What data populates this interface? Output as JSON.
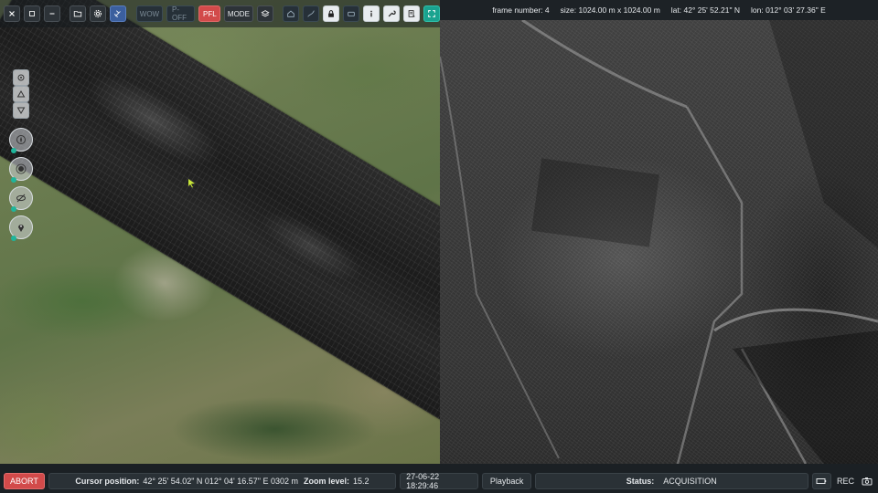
{
  "toolbar": {
    "wow_label": "WOW",
    "poff_label": "P-OFF",
    "pfl_label": "PFL",
    "mode_label": "MODE"
  },
  "sar_info": {
    "frame_label": "frame number:",
    "frame_number": "4",
    "size_label": "size:",
    "size_value": "1024.00 m  x 1024.00 m",
    "lat_label": "lat:",
    "lat_value": "42° 25' 52.21\" N",
    "lon_label": "lon:",
    "lon_value": "012° 03' 27.36\" E"
  },
  "statusbar": {
    "abort_label": "ABORT",
    "cursor_label": "Cursor position:",
    "cursor_value": "42° 25' 54.02\" N 012° 04' 16.57\" E 0302 m",
    "zoom_label": "Zoom level:",
    "zoom_value": "15.2",
    "datetime": "27-06-22 18:29:46",
    "playback_label": "Playback",
    "status_label": "Status:",
    "status_value": "ACQUISITION",
    "rec_label": "REC"
  },
  "icons": [
    "close-icon",
    "window-icon",
    "minimize-icon",
    "folder-icon",
    "gear-icon",
    "satellite-icon",
    "layers-icon",
    "home-icon",
    "route-icon",
    "lock-icon",
    "camera-icon",
    "info-icon",
    "wrench-icon",
    "report-icon",
    "fullscreen-icon",
    "battery-icon"
  ],
  "colors": {
    "accent_red": "#d24a4a",
    "accent_teal": "#1aa38f",
    "accent_blue": "#3b5f9e",
    "cursor_green": "#c8e63a"
  }
}
